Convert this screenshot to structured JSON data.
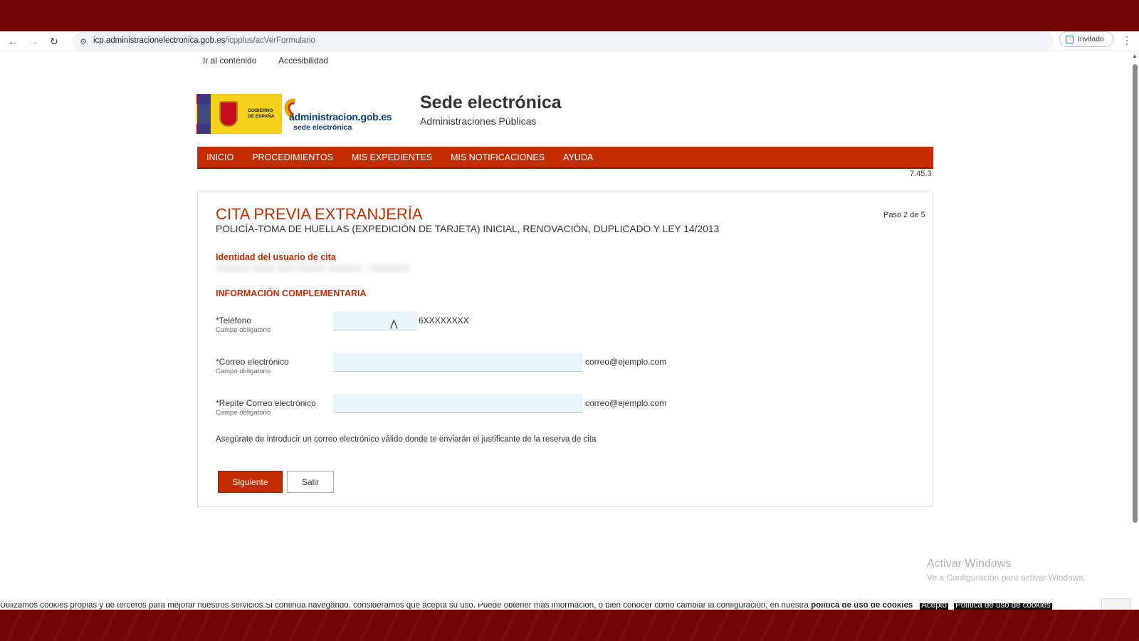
{
  "browser": {
    "url_host": "icp.administracionelectronica.gob.es",
    "url_path": "/icpplus/acVerFormulario",
    "profile_label": "Invitado",
    "icons": [
      "back-icon",
      "forward-icon",
      "reload-icon",
      "site-info-icon",
      "profile-icon",
      "menu-icon"
    ]
  },
  "skiplinks": {
    "content": "Ir al contenido",
    "accessibility": "Accesibilidad"
  },
  "logo": {
    "gov_line1": "GOBIERNO",
    "gov_line2": "DE ESPAÑA",
    "admin_text": "administracion.gob.es",
    "admin_sub": "sede electrónica"
  },
  "site": {
    "title": "Sede electrónica",
    "subtitle": "Administraciones Públicas"
  },
  "nav": {
    "items": [
      "INICIO",
      "PROCEDIMIENTOS",
      "MIS EXPEDIENTES",
      "MIS NOTIFICACIONES",
      "AYUDA"
    ]
  },
  "version": "7.45.3",
  "form": {
    "heading": "CITA PREVIA EXTRANJERÍA",
    "subheading": "POLICÍA-TOMA DE HUELLAS (EXPEDICIÓN DE TARJETA) INICIAL, RENOVACIÓN, DUPLICADO Y LEY 14/2013",
    "step": "Paso 2 de 5",
    "identity_label": "Identidad del usuario de cita",
    "identity_value": "XXXXXX XXXX XXX XXXXX XXXXXX - XXXXXXX",
    "info_label": "INFORMACIÓN COMPLEMENTARIA",
    "fields": [
      {
        "label": "*Teléfono",
        "required": "Campo obligatorio",
        "value": "",
        "hint": "6XXXXXXXX"
      },
      {
        "label": "*Correo electrónico",
        "required": "Campo obligatorio",
        "value": "",
        "hint": "correo@ejemplo.com"
      },
      {
        "label": "*Repite Correo electrónico",
        "required": "Campo obligatorio",
        "value": "",
        "hint": "correo@ejemplo.com"
      }
    ],
    "note": "Asegúrate de introducir un correo electrónico válido donde te enviarán el justificante de la reserva de cita",
    "next_label": "Siguiente",
    "exit_label": "Salir"
  },
  "watermark": {
    "line1": "Activar Windows",
    "line2": "Ve a Configuración para activar Windows."
  },
  "cookies": {
    "text": "Utilizamos cookies propias y de terceros para mejorar nuestros servicios.Si continúa navegando, consideramos que acepta su uso. Puede obtener más información, o bien conocer cómo cambiar la configuración, en nuestra ",
    "policy_bold": "política de uso de cookies",
    "accept": "Acepto",
    "policy_link": "Política de uso de cookies"
  },
  "colors": {
    "brand_red": "#c42d00",
    "desktop_band": "#730707",
    "input_bg": "#e7f5f8"
  }
}
